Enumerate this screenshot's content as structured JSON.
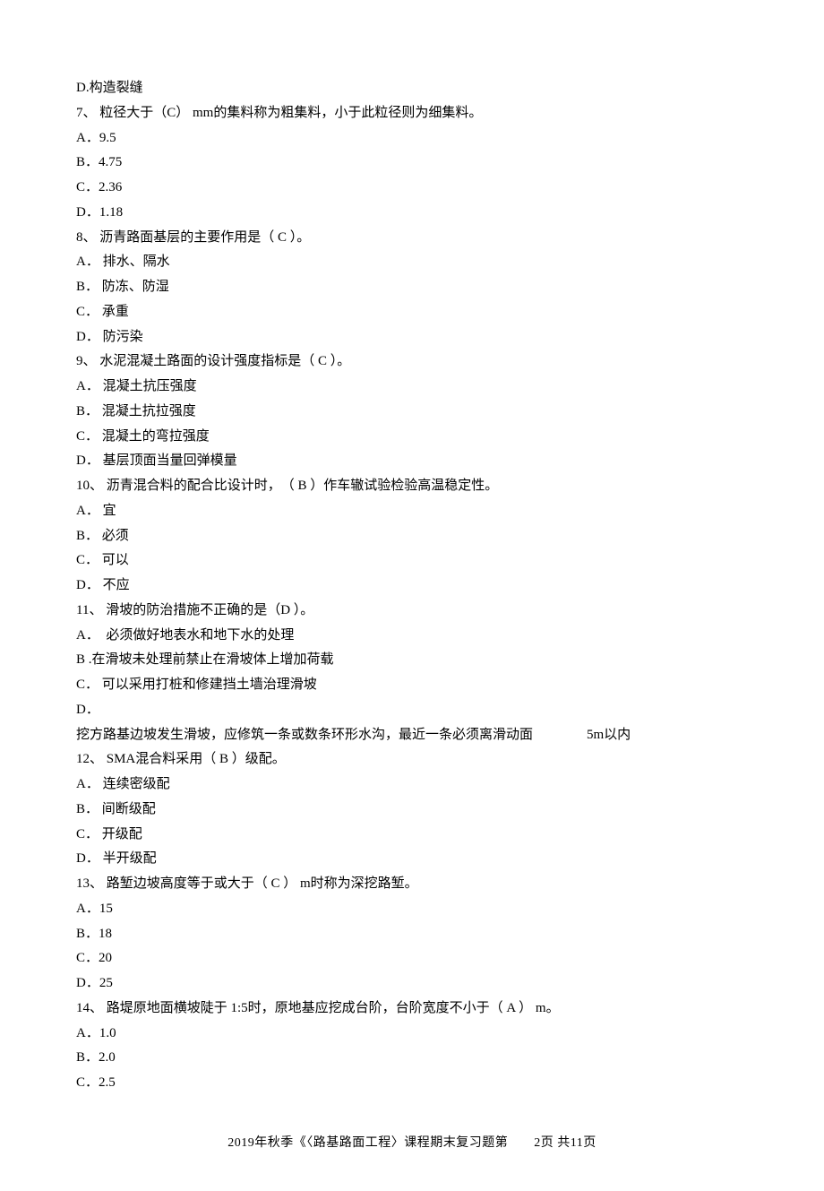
{
  "lines": [
    "D.构造裂缝",
    "7、 粒径大于（C） mm的集料称为粗集料，小于此粒径则为细集料。",
    "A．9.5",
    "B．4.75",
    "C．2.36",
    "D．1.18",
    "8、 沥青路面基层的主要作用是（ C ）。",
    "A． 排水、隔水",
    "B． 防冻、防湿",
    "C． 承重",
    "D． 防污染",
    "9、 水泥混凝土路面的设计强度指标是（ C ）。",
    "A． 混凝土抗压强度",
    "B． 混凝土抗拉强度",
    "C． 混凝土的弯拉强度",
    "D． 基层顶面当量回弹模量",
    "10、 沥青混合料的配合比设计时，　（ B ）作车辙试验检验高温稳定性。",
    "A． 宜",
    "B． 必须",
    "C． 可以",
    "D． 不应",
    "11、 滑坡的防治措施不正确的是（D ）。",
    "A．　必须做好地表水和地下水的处理",
    "B .在滑坡未处理前禁止在滑坡体上增加荷载",
    "C． 可以采用打桩和修建挡土墙治理滑坡",
    "D．",
    "挖方路基边坡发生滑坡，应修筑一条或数条环形水沟，最近一条必须离滑动面　　　　5m以内",
    "12、 SMA混合料采用（ B ）级配。",
    "A． 连续密级配",
    "B． 间断级配",
    "C． 开级配",
    "D． 半开级配",
    "13、 路堑边坡高度等于或大于（ C ） m时称为深挖路堑。",
    "A．15",
    "B．18",
    "C．20",
    "D．25",
    "14、 路堤原地面横坡陡于 1:5时，原地基应挖成台阶，台阶宽度不小于（ A ） m。",
    "A．1.0",
    "B．2.0",
    "C．2.5"
  ],
  "footer": "2019年秋季《〈路基路面工程〉课程期末复习题第　　2页 共11页"
}
